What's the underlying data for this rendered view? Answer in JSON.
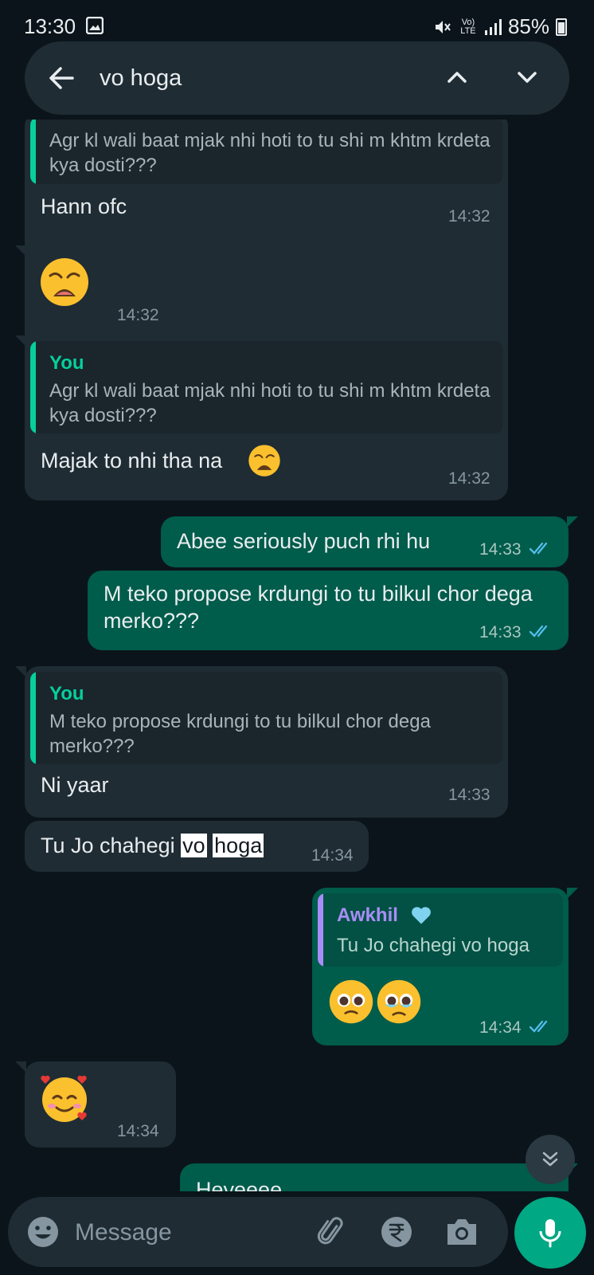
{
  "status_bar": {
    "time": "13:30",
    "signal_text": "Vo) LTE",
    "battery": "85%"
  },
  "search": {
    "query": "vo hoga"
  },
  "messages": [
    {
      "quote_text": "Agr kl wali baat mjak nhi hoti to tu shi m khtm krdeta kya dosti???",
      "text": "Hann ofc",
      "time": "14:32"
    },
    {
      "emoji": "weary-face",
      "time": "14:32"
    },
    {
      "quote_author": "You",
      "quote_text": "Agr kl wali baat mjak nhi hoti to tu shi m khtm krdeta kya dosti???",
      "text": "Majak to nhi tha na",
      "time": "14:32"
    },
    {
      "text": "Abee seriously puch rhi hu",
      "time": "14:33"
    },
    {
      "text": "M teko propose krdungi to tu bilkul chor dega merko???",
      "time": "14:33"
    },
    {
      "quote_author": "You",
      "quote_text": "M teko propose krdungi to tu bilkul chor dega merko???",
      "text": "Ni yaar",
      "time": "14:33"
    },
    {
      "text_before": "Tu Jo chahegi ",
      "highlight_1": "vo",
      "highlight_2": "hoga",
      "time": "14:34"
    },
    {
      "quote_author": "Awkhil",
      "quote_text": "Tu Jo chahegi vo hoga",
      "emoji": "pleading-face",
      "time": "14:34"
    },
    {
      "emoji": "smiling-face-with-hearts",
      "time": "14:34"
    },
    {
      "text": "Heyeeee"
    }
  ],
  "composer": {
    "placeholder": "Message"
  },
  "colors": {
    "background": "#0b141a",
    "incoming": "#1f2c34",
    "outgoing": "#005c4b",
    "accent": "#00a884",
    "read_ticks": "#53bdeb"
  }
}
